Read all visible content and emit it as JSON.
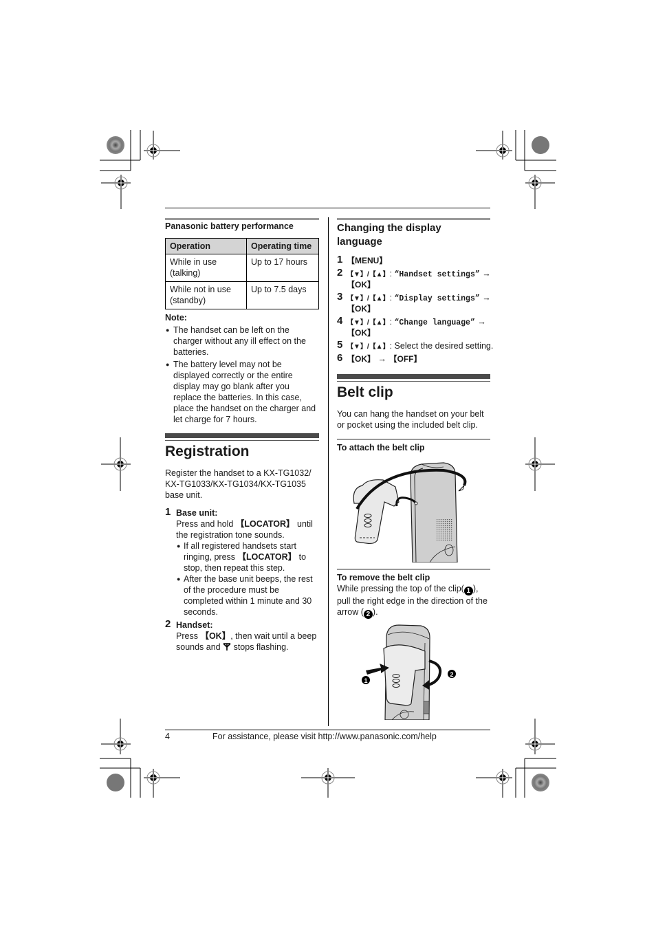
{
  "left_column": {
    "battery": {
      "title": "Panasonic battery performance",
      "headers": [
        "Operation",
        "Operating time"
      ],
      "rows": [
        [
          "While in use\n(talking)",
          "Up to 17 hours"
        ],
        [
          "While not in use\n(standby)",
          "Up to 7.5 days"
        ]
      ],
      "row_lines": [
        {
          "op1": "While in use",
          "op2": "(talking)",
          "time": "Up to 17 hours"
        },
        {
          "op1": "While not in use",
          "op2": "(standby)",
          "time": "Up to 7.5 days"
        }
      ]
    },
    "note": {
      "label": "Note:",
      "bullets": [
        {
          "lines": [
            "The handset can be left on the",
            "charger without any ill effect on the",
            "batteries."
          ]
        },
        {
          "lines": [
            "The battery level may not be",
            "displayed correctly or the entire",
            "display may go blank after you",
            "replace the batteries. In this case,",
            "place the handset on the charger and",
            "let charge for 7 hours."
          ]
        }
      ]
    },
    "registration": {
      "title": "Registration",
      "intro_lines": [
        "Register the handset to a KX-TG1032/",
        "KX-TG1033/KX-TG1034/KX-TG1035",
        "base unit."
      ],
      "steps": [
        {
          "num": "1",
          "label": "Base unit:",
          "line1_pre": "Press and hold ",
          "line1_key": "【LOCATOR】",
          "line1_post": " until",
          "line2": "the registration tone sounds.",
          "bullets": [
            {
              "l1_pre": "If all registered handsets start",
              "l2_pre": "ringing, press ",
              "l2_key": "【LOCATOR】",
              "l2_post": " to",
              "l3": "stop, then repeat this step."
            },
            {
              "lines": [
                "After the base unit beeps, the rest",
                "of the procedure must be",
                "completed within 1 minute and 30",
                "seconds."
              ]
            }
          ]
        },
        {
          "num": "2",
          "label": "Handset:",
          "line1_pre": "Press ",
          "line1_key": "【OK】",
          "line1_post": ", then wait until a beep",
          "line2_pre": "sounds and ",
          "line2_icon": "antenna-icon",
          "line2_post": " stops flashing."
        }
      ]
    }
  },
  "right_column": {
    "display_language": {
      "title_line1": "Changing the display",
      "title_line2": "language",
      "nav_keys": "【▼】/【▲】",
      "steps": [
        {
          "num": "1",
          "key": "【MENU】"
        },
        {
          "num": "2",
          "menu_item": "“Handset settings”",
          "arrow": "→",
          "next_key": "【OK】"
        },
        {
          "num": "3",
          "menu_item": "“Display settings”",
          "arrow": "→",
          "next_key": "【OK】"
        },
        {
          "num": "4",
          "menu_item": "“Change language”",
          "arrow": "→",
          "next_key": "【OK】"
        },
        {
          "num": "5",
          "text": ": Select the desired setting."
        },
        {
          "num": "6",
          "key1": "【OK】",
          "arrow": "→",
          "key2": "【OFF】"
        }
      ]
    },
    "belt_clip": {
      "title": "Belt clip",
      "intro_lines": [
        "You can hang the handset on your belt",
        "or pocket using the included belt clip."
      ],
      "attach": {
        "subtitle": "To attach the belt clip",
        "figure": "belt-clip-attach-illustration"
      },
      "remove": {
        "subtitle": "To remove the belt clip",
        "line1_pre": "While pressing the top of the clip(",
        "callout1": "1",
        "line1_post": "),",
        "line2": "pull the right edge in the direction of the",
        "line3_pre": "arrow (",
        "callout2": "2",
        "line3_post": ").",
        "figure": "belt-clip-remove-illustration"
      }
    }
  },
  "footer": {
    "page_number": "4",
    "assistance_text": "For assistance, please visit http://www.panasonic.com/help"
  }
}
